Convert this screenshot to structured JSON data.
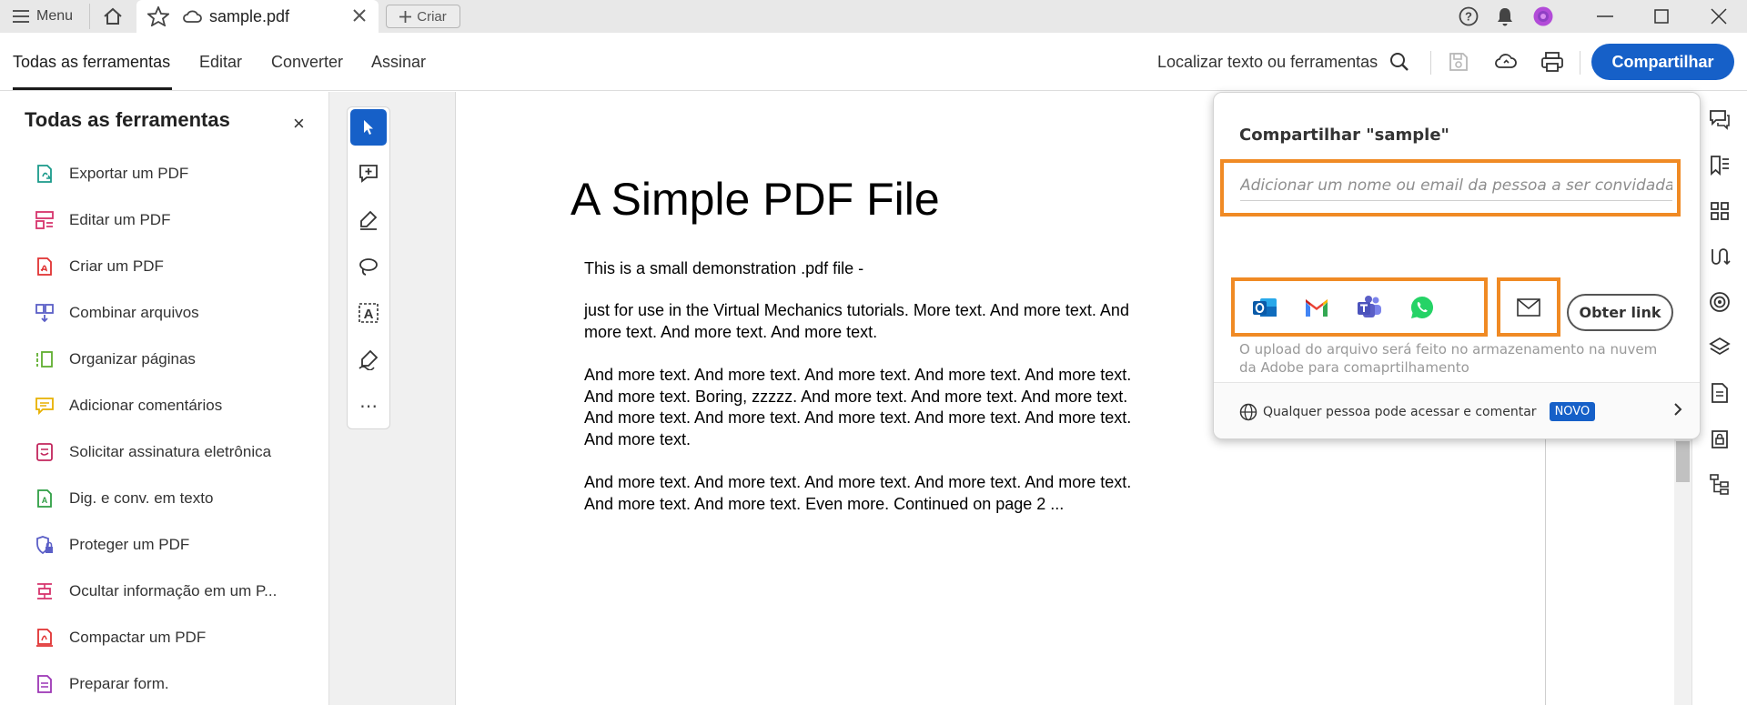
{
  "titlebar": {
    "menu_label": "Menu",
    "tab_title": "sample.pdf",
    "new_tab_label": "Criar"
  },
  "toolbar": {
    "tabs": [
      {
        "label": "Todas as ferramentas"
      },
      {
        "label": "Editar"
      },
      {
        "label": "Converter"
      },
      {
        "label": "Assinar"
      }
    ],
    "search_label": "Localizar texto ou ferramentas",
    "share_label": "Compartilhar"
  },
  "left_panel": {
    "title": "Todas as ferramentas",
    "close_glyph": "×",
    "items": [
      {
        "label": "Exportar um PDF",
        "icon": "export-pdf-icon"
      },
      {
        "label": "Editar um PDF",
        "icon": "edit-pdf-icon"
      },
      {
        "label": "Criar um PDF",
        "icon": "create-pdf-icon"
      },
      {
        "label": "Combinar arquivos",
        "icon": "combine-files-icon"
      },
      {
        "label": "Organizar páginas",
        "icon": "organize-pages-icon"
      },
      {
        "label": "Adicionar comentários",
        "icon": "add-comment-icon"
      },
      {
        "label": "Solicitar assinatura eletrônica",
        "icon": "request-esign-icon"
      },
      {
        "label": "Dig. e conv. em texto",
        "icon": "scan-ocr-icon"
      },
      {
        "label": "Proteger um PDF",
        "icon": "protect-pdf-icon"
      },
      {
        "label": "Ocultar informação em um P...",
        "icon": "redact-icon"
      },
      {
        "label": "Compactar um PDF",
        "icon": "compress-pdf-icon"
      },
      {
        "label": "Preparar form.",
        "icon": "prepare-form-icon"
      }
    ]
  },
  "quick_tools": {
    "more_glyph": "⋯"
  },
  "document": {
    "title": "A Simple PDF File",
    "paragraphs": [
      "This is a small demonstration .pdf file -",
      "just for use in the Virtual Mechanics tutorials. More text. And more text. And more text. And more text. And more text.",
      "And more text. And more text. And more text. And more text. And more text. And more text. Boring, zzzzz. And more text. And more text. And more text. And more text. And more text. And more text. And more text. And more text. And more text.",
      "And more text. And more text. And more text. And more text. And more text. And more text. And more text. Even more. Continued on page 2 ..."
    ]
  },
  "share_popover": {
    "title": "Compartilhar \"sample\"",
    "invite_placeholder": "Adicionar um nome ou email da pessoa a ser convidada",
    "apps": [
      {
        "name": "Outlook",
        "icon": "outlook-icon",
        "color": "#0f6cbd"
      },
      {
        "name": "Gmail",
        "icon": "gmail-icon",
        "color": "#ea4335"
      },
      {
        "name": "Teams",
        "icon": "teams-icon",
        "color": "#5b5fc7"
      },
      {
        "name": "WhatsApp",
        "icon": "whatsapp-icon",
        "color": "#25d366"
      }
    ],
    "get_link_label": "Obter link",
    "upload_note": "O upload do arquivo será feito no armazenamento na nuvem da Adobe para comaprtilhamento",
    "access_label": "Qualquer pessoa pode acessar e comentar",
    "new_badge": "NOVO"
  },
  "colors": {
    "accent": "#1660c8",
    "highlight": "#f08a24"
  }
}
